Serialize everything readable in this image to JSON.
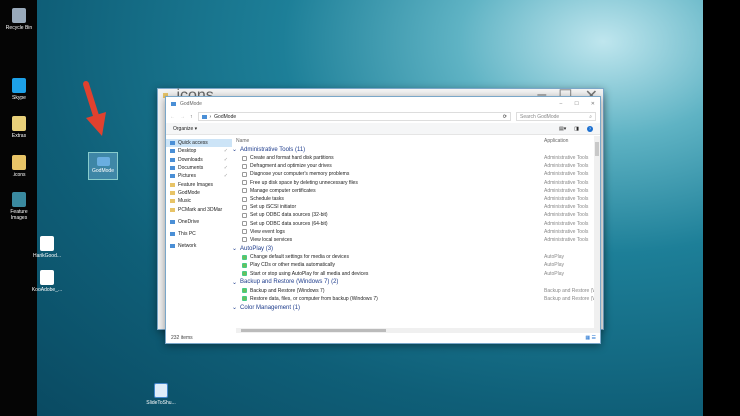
{
  "desktop": {
    "icons": [
      {
        "label": "Recycle Bin",
        "color": "#9ab"
      },
      {
        "label": "Skype",
        "color": "#1da1e8"
      },
      {
        "label": "Extras",
        "color": "#e8d07a"
      },
      {
        "label": ".icons",
        "color": "#e8c467"
      },
      {
        "label": "Feature Images",
        "color": "#3a8aa0"
      },
      {
        "label": "HarikGood...",
        "color": "#fff"
      },
      {
        "label": "KooAdobe_...",
        "color": "#fff"
      }
    ],
    "godmode_icon": "GodMode",
    "bottom_icon": "SlideToShu..."
  },
  "back_window": {
    "title": ".icons"
  },
  "window": {
    "title": "GodMode",
    "path": "GodMode",
    "search_placeholder": "Search GodMode",
    "organize": "Organize ▾",
    "status": "232 items",
    "columns": {
      "name": "Name",
      "application": "Application"
    },
    "nav": [
      {
        "label": "Quick access",
        "sel": true
      },
      {
        "label": "Desktop",
        "pin": true
      },
      {
        "label": "Downloads",
        "pin": true
      },
      {
        "label": "Documents",
        "pin": true
      },
      {
        "label": "Pictures",
        "pin": true
      },
      {
        "label": "Feature Images"
      },
      {
        "label": "GodMode"
      },
      {
        "label": "Music"
      },
      {
        "label": "PCMark and 3DMar"
      },
      {
        "sp": true
      },
      {
        "label": "OneDrive"
      },
      {
        "sp": true
      },
      {
        "label": "This PC"
      },
      {
        "sp": true
      },
      {
        "label": "Network"
      }
    ],
    "groups": [
      {
        "title": "Administrative Tools (11)",
        "icon": "tool",
        "items": [
          [
            "Create and format hard disk partitions",
            "Administrative Tools"
          ],
          [
            "Defragment and optimize your drives",
            "Administrative Tools"
          ],
          [
            "Diagnose your computer's memory problems",
            "Administrative Tools"
          ],
          [
            "Free up disk space by deleting unnecessary files",
            "Administrative Tools"
          ],
          [
            "Manage computer certificates",
            "Administrative Tools"
          ],
          [
            "Schedule tasks",
            "Administrative Tools"
          ],
          [
            "Set up iSCSI initiator",
            "Administrative Tools"
          ],
          [
            "Set up ODBC data sources (32-bit)",
            "Administrative Tools"
          ],
          [
            "Set up ODBC data sources (64-bit)",
            "Administrative Tools"
          ],
          [
            "View event logs",
            "Administrative Tools"
          ],
          [
            "View local services",
            "Administrative Tools"
          ]
        ]
      },
      {
        "title": "AutoPlay (3)",
        "icon": "green",
        "items": [
          [
            "Change default settings for media or devices",
            "AutoPlay"
          ],
          [
            "Play CDs or other media automatically",
            "AutoPlay"
          ],
          [
            "Start or stop using AutoPlay for all media and devices",
            "AutoPlay"
          ]
        ]
      },
      {
        "title": "Backup and Restore (Windows 7) (2)",
        "icon": "green",
        "items": [
          [
            "Backup and Restore (Windows 7)",
            "Backup and Restore (Wind"
          ],
          [
            "Restore data, files, or computer from backup (Windows 7)",
            "Backup and Restore (Wind"
          ]
        ]
      },
      {
        "title": "Color Management (1)",
        "icon": "tool",
        "items": []
      }
    ]
  }
}
